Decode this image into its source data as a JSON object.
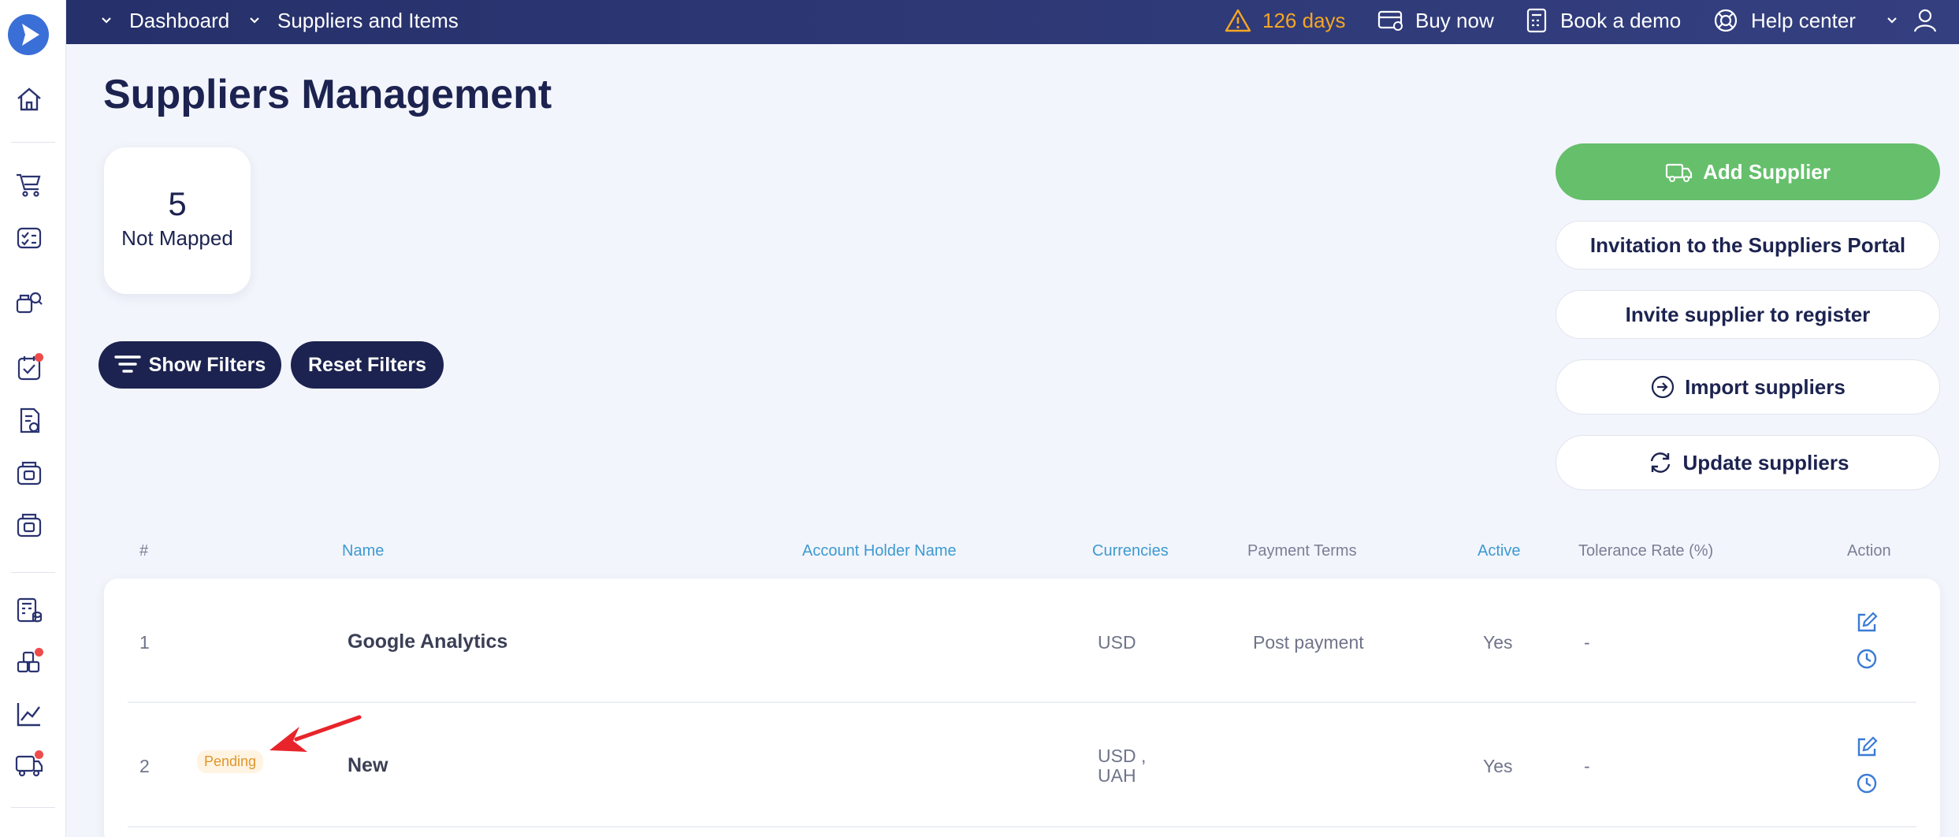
{
  "topbar": {
    "breadcrumb": [
      "Dashboard",
      "Suppliers and Items"
    ],
    "trial_days": "126 days",
    "buy_now": "Buy now",
    "book_demo": "Book a demo",
    "help_center": "Help center"
  },
  "page": {
    "title": "Suppliers Management"
  },
  "stats": {
    "value": "5",
    "label": "Not Mapped"
  },
  "filters": {
    "show": "Show Filters",
    "reset": "Reset Filters"
  },
  "actions": {
    "add_supplier": "Add Supplier",
    "invitation_portal": "Invitation to the Suppliers Portal",
    "invite_register": "Invite supplier to register",
    "import": "Import suppliers",
    "update": "Update suppliers"
  },
  "table": {
    "headers": [
      "#",
      "Name",
      "Account Holder Name",
      "Currencies",
      "Payment Terms",
      "Active",
      "Tolerance Rate (%)",
      "Action"
    ],
    "rows": [
      {
        "num": "1",
        "badge": "",
        "name": "Google Analytics",
        "account_holder": "",
        "currencies": [
          "USD"
        ],
        "payment_terms": "Post payment",
        "active": "Yes",
        "tolerance": "-"
      },
      {
        "num": "2",
        "badge": "Pending",
        "name": "New",
        "account_holder": "",
        "currencies": [
          "USD ,",
          "UAH"
        ],
        "payment_terms": "",
        "active": "Yes",
        "tolerance": "-"
      }
    ]
  },
  "colors": {
    "primary": "#1c2350",
    "accent_green": "#65bf6b",
    "link_blue": "#3d9ad1",
    "warning": "#f5a623",
    "notification": "#ef4b4b"
  }
}
